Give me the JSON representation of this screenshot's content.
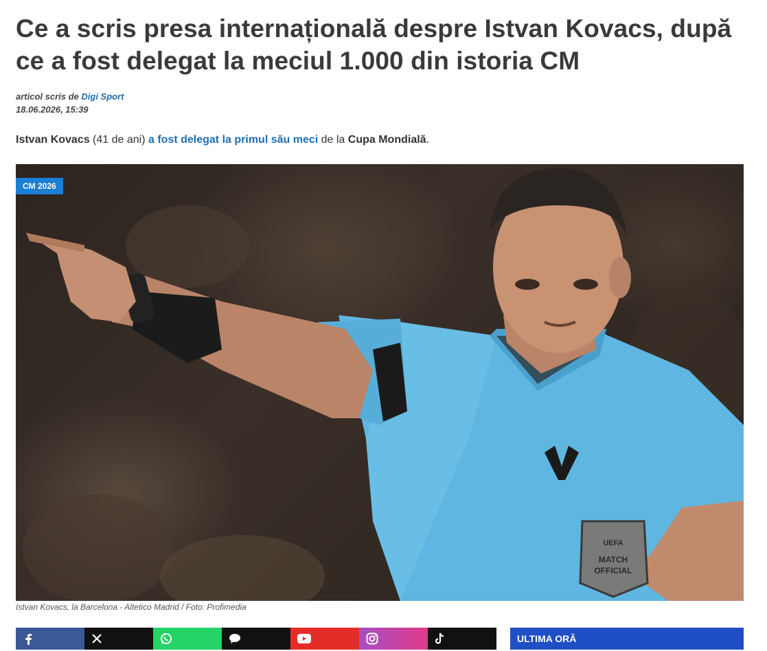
{
  "article": {
    "title": "Ce a scris presa internațională despre Istvan Kovacs, după ce a fost delegat la meciul 1.000 din istoria CM",
    "byline_prefix": "articol scris de ",
    "author": "Digi Sport",
    "date": "18.06.2026, 15:39",
    "lead": {
      "name": "Istvan Kovacs",
      "age": " (41 de ani) ",
      "link_text": "a fost delegat la primul său meci",
      "middle": " de la ",
      "competition": "Cupa Mondială",
      "end": "."
    }
  },
  "image": {
    "badge": "CM 2026",
    "caption": "Istvan Kovacs, la Barcelona - Altetico Madrid / Foto: Profimedia",
    "patch_line1": "UEFA",
    "patch_line2": "MATCH",
    "patch_line3": "OFFICIAL"
  },
  "share_icons": [
    "facebook-icon",
    "x-icon",
    "whatsapp-icon",
    "message-icon",
    "youtube-icon",
    "instagram-icon",
    "tiktok-icon"
  ],
  "sidebar": {
    "ultima_ora": "ULTIMA ORĂ"
  },
  "colors": {
    "link": "#1f6fb0",
    "badge": "#1c7fd6",
    "ultima_ora_bg": "#1f4fc4",
    "facebook": "#3b5998",
    "whatsapp": "#25d366",
    "youtube": "#e52d27"
  }
}
